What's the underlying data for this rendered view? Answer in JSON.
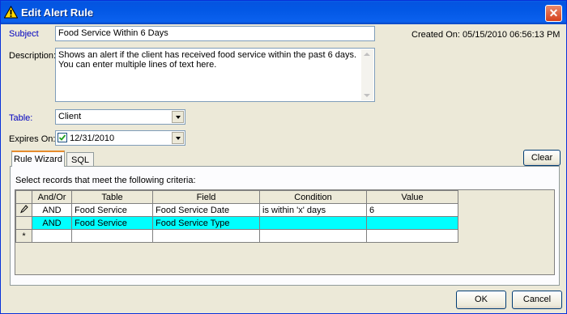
{
  "window": {
    "title": "Edit Alert Rule",
    "title_icon": "warning-icon",
    "close_symbol": "✕"
  },
  "form": {
    "subject_label": "Subject",
    "subject_value": "Food Service Within 6 Days",
    "created_on": "Created On: 05/15/2010 06:56:13 PM",
    "description_label": "Description:",
    "description_line1": "Shows an alert if the client has received food service within the past 6 days.",
    "description_line2": "You can enter multiple lines of text here.",
    "table_label": "Table:",
    "table_value": "Client",
    "expires_label": "Expires On:",
    "expires_checked": true,
    "expires_value": "12/31/2010"
  },
  "tabs": [
    {
      "label": "Rule Wizard",
      "active": true
    },
    {
      "label": "SQL",
      "active": false
    }
  ],
  "clear_label": "Clear",
  "criteria_label": "Select records that meet the following criteria:",
  "grid": {
    "columns": [
      "And/Or",
      "Table",
      "Field",
      "Condition",
      "Value"
    ],
    "rows": [
      {
        "indicator": "pencil",
        "andor": "AND",
        "table": "Food Service",
        "field": "Food Service Date",
        "condition": "is within 'x' days",
        "value": "6"
      },
      {
        "indicator": "",
        "andor": "AND",
        "table": "Food Service",
        "field": "Food Service Type",
        "condition": "",
        "value": ""
      }
    ],
    "new_row_symbol": "*"
  },
  "buttons": {
    "ok": "OK",
    "cancel": "Cancel"
  },
  "colors": {
    "title_bar": "#0454e0",
    "highlight_row": "#00ffff",
    "label_blue": "#0000c0"
  }
}
